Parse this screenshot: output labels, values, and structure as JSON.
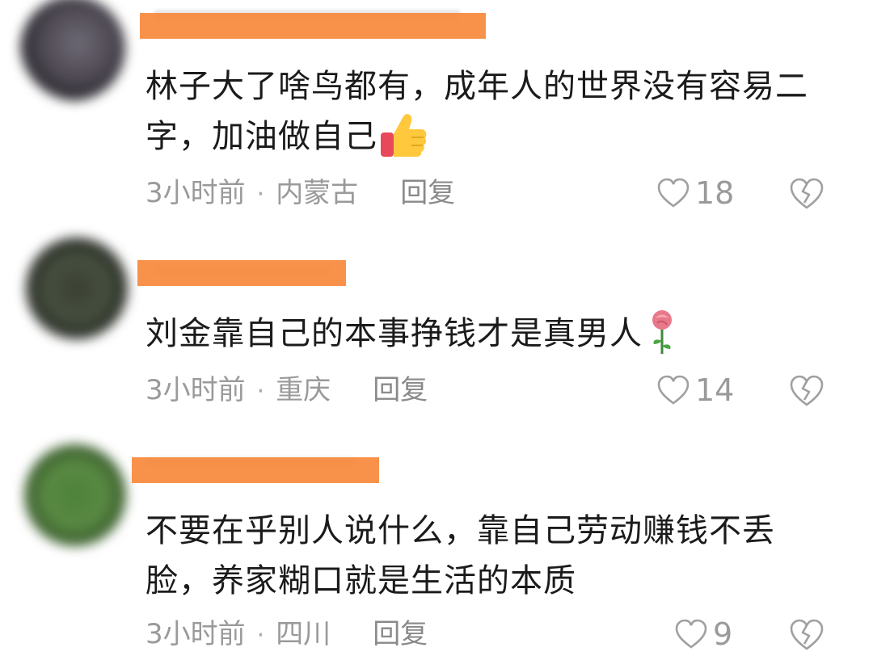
{
  "comments": [
    {
      "username": "",
      "text": "林子大了啥鸟都有，成年人的世界没有容易二字，加油做自己",
      "emoji": "thumbs-up-icon",
      "time": "3小时前",
      "separator": "·",
      "location": "内蒙古",
      "reply_label": "回复",
      "likes": "18",
      "avatar_color": "#5a5560"
    },
    {
      "username": "",
      "text": "刘金靠自己的本事挣钱才是真男人",
      "emoji": "rose-icon",
      "time": "3小时前",
      "separator": "·",
      "location": "重庆",
      "reply_label": "回复",
      "likes": "14",
      "avatar_color": "#3f4538"
    },
    {
      "username": "",
      "text": "不要在乎别人说什么，靠自己劳动赚钱不丢脸，养家糊口就是生活的本质",
      "emoji": "",
      "time": "3小时前",
      "separator": "·",
      "location": "四川",
      "reply_label": "回复",
      "likes": "9",
      "avatar_color": "#4f7a3c"
    }
  ],
  "colors": {
    "redaction": "#f7893c",
    "meta_text": "#9a9a9a",
    "body_text": "#1b1b1b"
  }
}
